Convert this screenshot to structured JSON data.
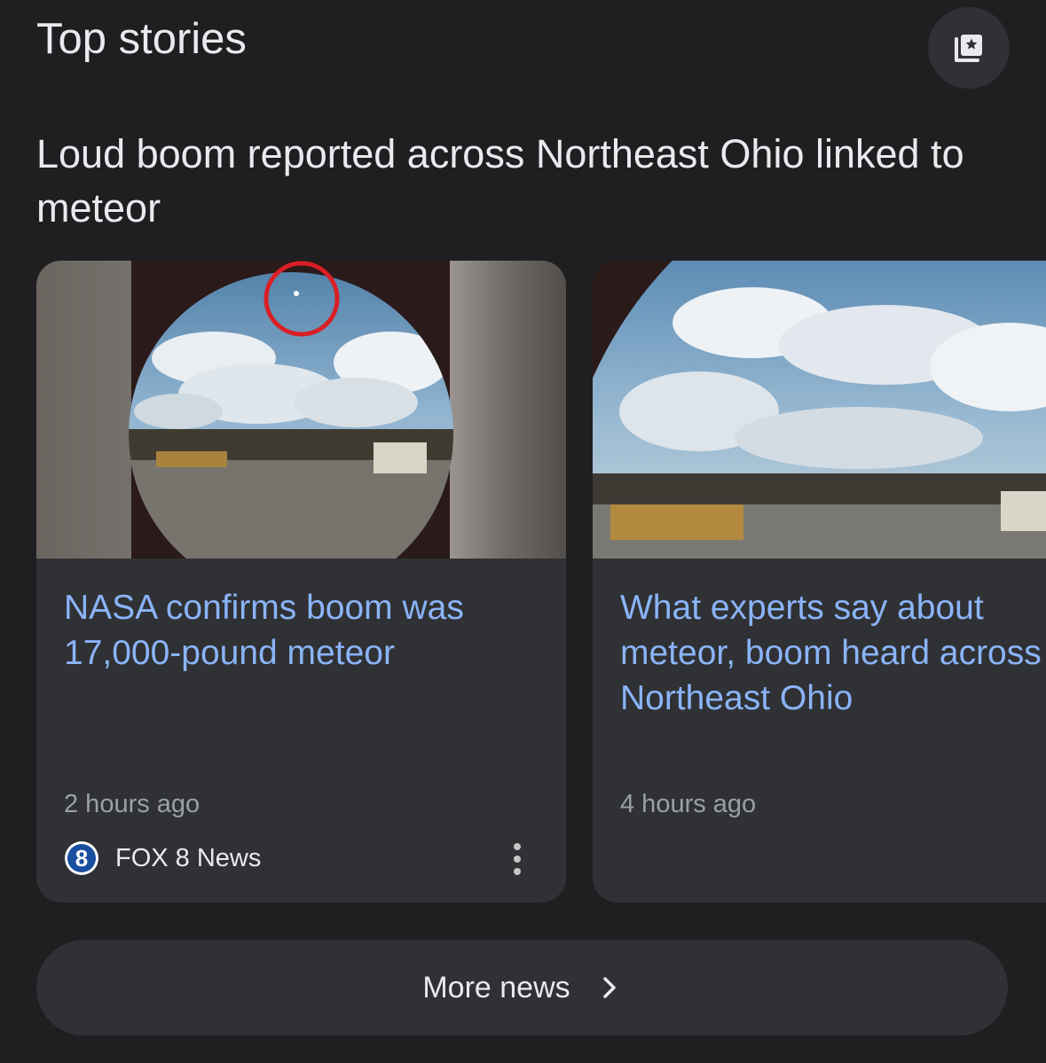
{
  "section": {
    "title": "Top stories",
    "save_icon": "save-to-collection-icon"
  },
  "headline": "Loud boom reported across Northeast Ohio linked to meteor",
  "cards": [
    {
      "title": "NASA confirms boom was 17,000-pound meteor",
      "time": "2 hours ago",
      "source": "FOX 8 News",
      "source_logo_glyph": "8",
      "menu_icon": "more-vert-icon"
    },
    {
      "title_lines": [
        "What experts say about",
        "meteor, boom heard across",
        "Northeast Ohio"
      ],
      "time": "4 hours ago"
    }
  ],
  "more_news": {
    "label": "More news",
    "icon": "chevron-right-icon"
  },
  "colors": {
    "background": "#1f1f21",
    "surface": "#303134",
    "link": "#8ab4f8",
    "text": "#e8eaed",
    "muted": "#9aa0a6",
    "highlight_circle": "#d91f26"
  }
}
